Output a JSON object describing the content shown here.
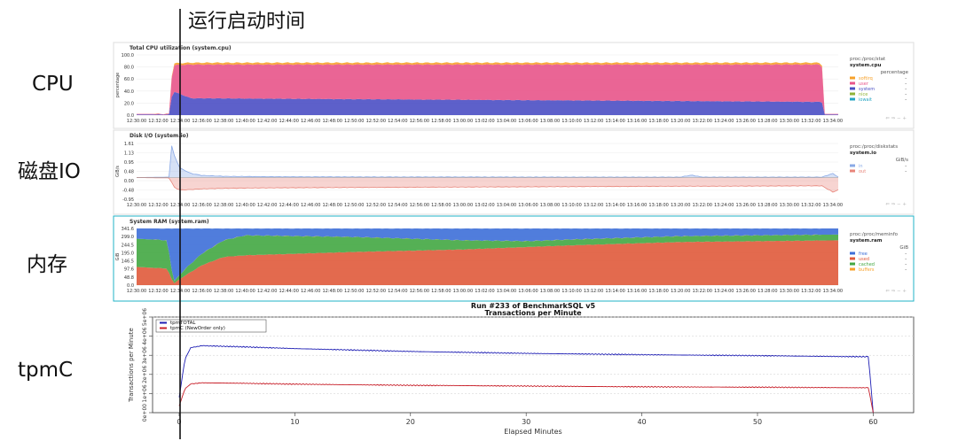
{
  "annotation": {
    "caption": "运行启动时间"
  },
  "row_labels": [
    "CPU",
    "磁盘IO",
    "内存",
    "tpmC"
  ],
  "chart_data": [
    {
      "type": "area",
      "title": "Total CPU utilization (system.cpu)",
      "ylabel": "percentage",
      "yticks": [
        "100.0",
        "80.0",
        "60.0",
        "40.0",
        "20.0",
        "0.0"
      ],
      "ylim": [
        0,
        100
      ],
      "xticks": [
        "12:30:00",
        "12:32:00",
        "12:34:00",
        "12:36:00",
        "12:38:00",
        "12:40:00",
        "12:42:00",
        "12:44:00",
        "12:46:00",
        "12:48:00",
        "12:50:00",
        "12:52:00",
        "12:54:00",
        "12:56:00",
        "12:58:00",
        "13:00:00",
        "13:02:00",
        "13:04:00",
        "13:06:00",
        "13:08:00",
        "13:10:00",
        "13:12:00",
        "13:14:00",
        "13:16:00",
        "13:18:00",
        "13:20:00",
        "13:22:00",
        "13:24:00",
        "13:26:00",
        "13:28:00",
        "13:30:00",
        "13:32:00",
        "13:34:00"
      ],
      "x_minutes": [
        0,
        3,
        3.3,
        5,
        63,
        63.2,
        64.5
      ],
      "series": [
        {
          "name": "system",
          "color": "#4b4fc4",
          "values": [
            1,
            1,
            40,
            28,
            22,
            1,
            1
          ]
        },
        {
          "name": "user",
          "color": "#e8548a",
          "values": [
            1,
            1,
            43,
            56,
            62,
            1,
            1
          ]
        },
        {
          "name": "softirq",
          "color": "#f7a12a",
          "values": [
            0,
            0,
            3,
            3,
            3,
            0,
            0
          ]
        }
      ],
      "legend": {
        "source": "proc:/proc/stat",
        "chart": "system.cpu",
        "unit": "percentage",
        "items": [
          {
            "name": "softirq",
            "color": "#f7a12a",
            "value": "-"
          },
          {
            "name": "user",
            "color": "#e8548a",
            "value": "-"
          },
          {
            "name": "system",
            "color": "#4b4fc4",
            "value": "-"
          },
          {
            "name": "nice",
            "color": "#8fb338",
            "value": "-"
          },
          {
            "name": "iowait",
            "color": "#23a4c2",
            "value": "-"
          }
        ]
      },
      "legend_position": "right"
    },
    {
      "type": "area",
      "title": "Disk I/O (system.io)",
      "ylabel": "GiB/s",
      "yticks": [
        "1.61",
        "1.13",
        "0.95",
        "0.48",
        "0.00",
        "-0.48",
        "-0.95"
      ],
      "ylim": [
        -1.05,
        1.65
      ],
      "xticks": [
        "12:30:00",
        "12:32:00",
        "12:34:00",
        "12:36:00",
        "12:38:00",
        "12:40:00",
        "12:42:00",
        "12:44:00",
        "12:46:00",
        "12:48:00",
        "12:50:00",
        "12:52:00",
        "12:54:00",
        "12:56:00",
        "12:58:00",
        "13:00:00",
        "13:02:00",
        "13:04:00",
        "13:06:00",
        "13:08:00",
        "13:10:00",
        "13:12:00",
        "13:14:00",
        "13:16:00",
        "13:18:00",
        "13:20:00",
        "13:22:00",
        "13:24:00",
        "13:26:00",
        "13:28:00",
        "13:30:00",
        "13:32:00",
        "13:34:00"
      ],
      "x_minutes": [
        0,
        3,
        3.2,
        3.5,
        4,
        5,
        6,
        8,
        12,
        20,
        40,
        50,
        51,
        52,
        63,
        64,
        64.5
      ],
      "series": [
        {
          "name": "in",
          "color": "#8aa9e6",
          "values": [
            0,
            0.02,
            1.6,
            1.0,
            0.45,
            0.2,
            0.1,
            0.06,
            0.04,
            0.03,
            0.02,
            0.02,
            0.12,
            0.02,
            0.02,
            0.2,
            0.02
          ]
        },
        {
          "name": "out",
          "color": "#e8857a",
          "values": [
            0,
            -0.02,
            -0.2,
            -0.5,
            -0.6,
            -0.58,
            -0.55,
            -0.52,
            -0.5,
            -0.48,
            -0.44,
            -0.42,
            -0.42,
            -0.42,
            -0.4,
            -0.7,
            -0.6
          ]
        }
      ],
      "legend": {
        "source": "proc:/proc/diskstats",
        "chart": "system.io",
        "unit": "GiB/s",
        "items": [
          {
            "name": "in",
            "color": "#8aa9e6",
            "value": "-"
          },
          {
            "name": "out",
            "color": "#e8857a",
            "value": "-"
          }
        ]
      },
      "legend_position": "right"
    },
    {
      "type": "area",
      "title": "System RAM (system.ram)",
      "ylabel": "GiB",
      "yticks": [
        "341.6",
        "299.0",
        "244.5",
        "195.0",
        "146.5",
        "97.6",
        "48.8",
        "0.0"
      ],
      "ylim": [
        0,
        341.6
      ],
      "xticks": [
        "12:30:00",
        "12:32:00",
        "12:34:00",
        "12:36:00",
        "12:38:00",
        "12:40:00",
        "12:42:00",
        "12:44:00",
        "12:46:00",
        "12:48:00",
        "12:50:00",
        "12:52:00",
        "12:54:00",
        "12:56:00",
        "12:58:00",
        "13:00:00",
        "13:02:00",
        "13:04:00",
        "13:06:00",
        "13:08:00",
        "13:10:00",
        "13:12:00",
        "13:14:00",
        "13:16:00",
        "13:18:00",
        "13:20:00",
        "13:22:00",
        "13:24:00",
        "13:26:00",
        "13:28:00",
        "13:30:00",
        "13:32:00",
        "13:34:00"
      ],
      "x_minutes": [
        0,
        2.8,
        3.4,
        4.5,
        6,
        8,
        10,
        20,
        30,
        36,
        40,
        50,
        64.5
      ],
      "series": [
        {
          "name": "used",
          "color": "#e05a3b",
          "values": [
            110,
            100,
            10,
            60,
            120,
            170,
            180,
            200,
            215,
            230,
            240,
            260,
            270
          ]
        },
        {
          "name": "cached",
          "color": "#43a742",
          "values": [
            170,
            170,
            10,
            40,
            70,
            100,
            120,
            90,
            55,
            35,
            35,
            35,
            35
          ]
        },
        {
          "name": "buffers",
          "color": "#f7a12a",
          "values": [
            0,
            0,
            0,
            0,
            0,
            0,
            0,
            0,
            0,
            0,
            0,
            0,
            0
          ]
        },
        {
          "name": "free",
          "color": "#3d6fd8",
          "values": [
            61.6,
            71.6,
            321.6,
            241.6,
            151.6,
            71.6,
            41.6,
            51.6,
            71.6,
            76.6,
            66.6,
            46.6,
            36.6
          ]
        }
      ],
      "legend": {
        "source": "proc:/proc/meminfo",
        "chart": "system.ram",
        "unit": "GiB",
        "items": [
          {
            "name": "free",
            "color": "#3d6fd8",
            "value": "-"
          },
          {
            "name": "used",
            "color": "#e05a3b",
            "value": "-"
          },
          {
            "name": "cached",
            "color": "#43a742",
            "value": "-"
          },
          {
            "name": "buffers",
            "color": "#f7a12a",
            "value": "-"
          }
        ]
      },
      "legend_position": "right"
    },
    {
      "type": "line",
      "title": "Run #233 of BenchmarkSQL v5",
      "subtitle": "Transactions per Minute",
      "xlabel": "Elapsed Minutes",
      "ylabel": "Transactions per Minute",
      "xlim": [
        -2.3,
        63.5
      ],
      "ylim": [
        0,
        5000000
      ],
      "xticks": [
        0,
        10,
        20,
        30,
        40,
        50,
        60
      ],
      "yticks": [
        "0e+00",
        "1e+06",
        "2e+06",
        "3e+06",
        "4e+06",
        "5e+06"
      ],
      "series": [
        {
          "name": "tpmTOTAL",
          "color": "#1f1fb4",
          "x": [
            0,
            0.5,
            1,
            2,
            5,
            10,
            20,
            30,
            40,
            50,
            59.6,
            60
          ],
          "values": [
            800000,
            2800000,
            3400000,
            3500000,
            3450000,
            3350000,
            3200000,
            3100000,
            3030000,
            2980000,
            2920000,
            0
          ]
        },
        {
          "name": "tpmC (NewOrder only)",
          "color": "#c8202a",
          "x": [
            0,
            0.5,
            1,
            2,
            5,
            10,
            20,
            30,
            40,
            50,
            59.6,
            60
          ],
          "values": [
            350000,
            1250000,
            1500000,
            1560000,
            1540000,
            1490000,
            1430000,
            1390000,
            1350000,
            1330000,
            1300000,
            0
          ]
        }
      ],
      "legend_position": "top-left"
    }
  ]
}
